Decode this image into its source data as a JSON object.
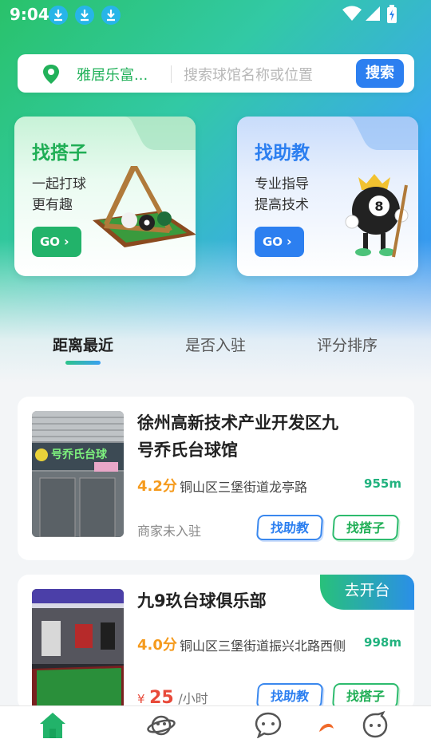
{
  "status_bar": {
    "time": "9:04"
  },
  "search": {
    "location": "雅居乐富...",
    "placeholder": "搜索球馆名称或位置",
    "button": "搜索"
  },
  "cards": [
    {
      "title": "找搭子",
      "line1": "一起打球",
      "line2": "更有趣",
      "go": "GO",
      "accent": "#1fae55"
    },
    {
      "title": "找助教",
      "line1": "专业指导",
      "line2": "提高技术",
      "go": "GO",
      "accent": "#2c7ff0"
    }
  ],
  "tabs": [
    {
      "label": "距离最近",
      "active": true
    },
    {
      "label": "是否入驻",
      "active": false
    },
    {
      "label": "评分排序",
      "active": false
    }
  ],
  "venues": [
    {
      "name": "徐州高新技术产业开发区九号乔氏台球馆",
      "rating": "4.2分",
      "address": "铜山区三堡街道龙亭路",
      "distance": "955m",
      "status": "商家未入驻",
      "btn_coach": "找助教",
      "btn_partner": "找搭子",
      "sign_text": "号乔氏台球"
    },
    {
      "name": "九9玖台球俱乐部",
      "rating": "4.0分",
      "address": "铜山区三堡街道振兴北路西侧",
      "distance": "998m",
      "price_symbol": "¥",
      "price": "25",
      "price_unit": "/小时",
      "ribbon": "去开台",
      "btn_coach": "找助教",
      "btn_partner": "找搭子"
    }
  ],
  "nav": [
    {
      "icon": "home-icon",
      "active": true
    },
    {
      "icon": "planet-icon",
      "active": false
    },
    {
      "icon": "chat-icon",
      "active": false
    },
    {
      "icon": "profile-icon",
      "active": false
    }
  ],
  "colors": {
    "green": "#1fae55",
    "blue": "#2c7ff0",
    "orange": "#f59a1c",
    "price_red": "#e84a3a"
  }
}
